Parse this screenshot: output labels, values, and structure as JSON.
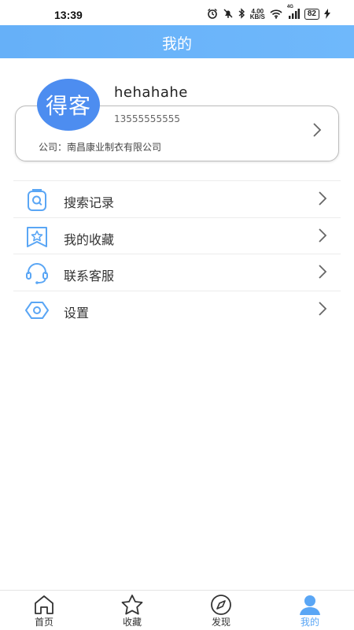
{
  "status_bar": {
    "time": "13:39",
    "network_speed": "4.00",
    "network_unit": "KB/S",
    "signal_type": "4G",
    "battery": "82"
  },
  "header": {
    "title": "我的"
  },
  "profile": {
    "avatar_text": "得客",
    "username": "hehahahe",
    "phone": "13555555555",
    "company": "公司：南昌康业制衣有限公司"
  },
  "menu": {
    "items": [
      {
        "label": "搜索记录",
        "icon": "search-history-icon"
      },
      {
        "label": "我的收藏",
        "icon": "star-bookmark-icon"
      },
      {
        "label": "联系客服",
        "icon": "headset-icon"
      },
      {
        "label": "设置",
        "icon": "settings-hexagon-icon"
      }
    ]
  },
  "bottom_nav": {
    "items": [
      {
        "label": "首页",
        "icon": "home-icon"
      },
      {
        "label": "收藏",
        "icon": "star-icon"
      },
      {
        "label": "发现",
        "icon": "compass-icon"
      },
      {
        "label": "我的",
        "icon": "person-icon"
      }
    ],
    "active_index": 3
  },
  "colors": {
    "accent": "#6ab4f9",
    "avatar_bg": "#4d8df0",
    "icon_blue": "#5aa6f5"
  }
}
